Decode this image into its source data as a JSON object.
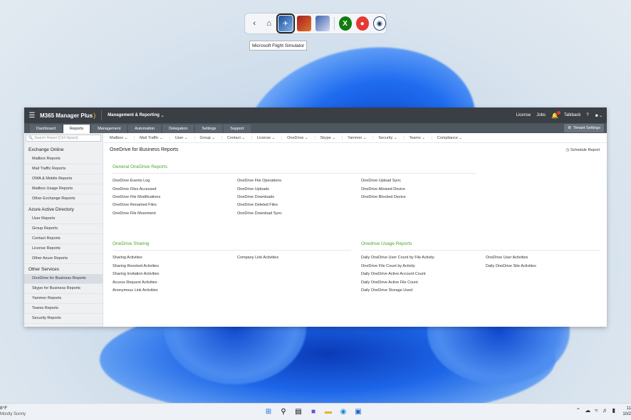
{
  "switcher": {
    "back_icon": "chevron-left-icon",
    "home_icon": "home-icon",
    "tooltip": "Microsoft Flight Simulator"
  },
  "app": {
    "brand": "M365 Manager Plus",
    "menu": "Management & Reporting",
    "top_links": [
      "License",
      "Jobs",
      "Talkback",
      "?"
    ],
    "tabs": [
      "Dashboard",
      "Reports",
      "Management",
      "Automation",
      "Delegation",
      "Settings",
      "Support"
    ],
    "active_tab": "Reports",
    "tenant_settings": "Tenant Settings",
    "search_placeholder": "Search Report [Ctrl+Space]",
    "sidebar": [
      {
        "group": "Exchange Online",
        "items": [
          "Mailbox Reports",
          "Mail Traffic Reports",
          "OWA & Mobile Reports",
          "Mailbox Usage Reports",
          "Other Exchange Reports"
        ]
      },
      {
        "group": "Azure Active Directory",
        "items": [
          "User Reports",
          "Group Reports",
          "Contact Reports",
          "License Reports",
          "Other Azure Reports"
        ]
      },
      {
        "group": "Other Services",
        "items": [
          "OneDrive for Business Reports",
          "Skype for Business Reports",
          "Yammer Reports",
          "Teams Reports",
          "Security Reports"
        ]
      }
    ],
    "active_sidebar_item": "OneDrive for Business Reports",
    "filters": [
      "Mailbox",
      "Mail Traffic",
      "User",
      "Group",
      "Contact",
      "License",
      "OneDrive",
      "Skype",
      "Yammer",
      "Security",
      "Teams",
      "Compliance"
    ],
    "page_title": "OneDrive for Business Reports",
    "schedule": "Schedule Report",
    "sections": {
      "general": {
        "title": "General OneDrive Reports",
        "col1": [
          "OneDrive Events Log",
          "OneDrive Files Accessed",
          "OneDrive File Modifications",
          "OneDrive Renamed Files",
          "OneDrive File Movement"
        ],
        "col2": [
          "OneDrive File Operations",
          "OneDrive Uploads",
          "OneDrive Downloads",
          "OneDrive Deleted Files",
          "OneDrive Download Sync"
        ],
        "col3": [
          "OneDrive Upload Sync",
          "OneDrive Allowed Device",
          "OneDrive Blocked Device"
        ]
      },
      "sharing": {
        "title": "OneDrive Sharing",
        "col1": [
          "Sharing Activities",
          "Sharing Revoked Activities",
          "Sharing Invitation Activities",
          "Access Request Activities",
          "Anonymous Link Activities"
        ],
        "col2": [
          "Company Link Activities"
        ]
      },
      "usage": {
        "title": "Onedrive Usage Reports",
        "col1": [
          "Daily OneDrive User Count by File Activity",
          "OneDrive File Count by Activity",
          "Daily OneDrive Active Account Count",
          "Daily OneDrive Active File Count",
          "Daily OneDrive Storage Used"
        ],
        "col2": [
          "OneDrive User Activities",
          "Daily OneDrive Site Activities"
        ]
      }
    }
  },
  "taskbar": {
    "temp": "8°F",
    "weather": "Mostly Sunny",
    "clock_time": "11",
    "clock_date": "10/2"
  }
}
